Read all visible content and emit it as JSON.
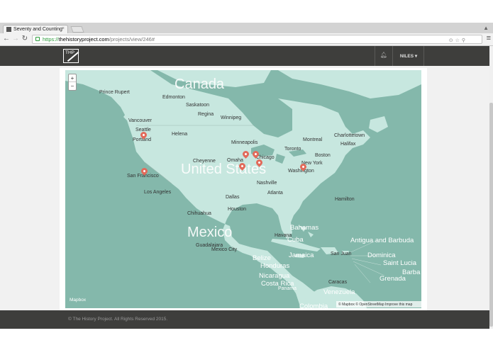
{
  "browser": {
    "tab_title": "Seventy and Counting",
    "url_scheme": "https://",
    "url_host": "thehistoryproject.com",
    "url_path": "/projects/view/246#"
  },
  "header": {
    "logo_text": "THP",
    "user_label": "NILES ▾"
  },
  "map": {
    "zoom_in": "+",
    "zoom_out": "−",
    "countries": {
      "canada": "Canada",
      "united_states": "United States",
      "mexico": "Mexico"
    },
    "cities": {
      "prince_rupert": "Prince Rupert",
      "edmonton": "Edmonton",
      "saskatoon": "Saskatoon",
      "regina": "Regina",
      "winnipeg": "Winnipeg",
      "vancouver": "Vancouver",
      "seattle": "Seattle",
      "portland": "Portland",
      "helena": "Helena",
      "minneapolis": "Minneapolis",
      "cheyenne": "Cheyenne",
      "omaha": "Omaha",
      "chicago": "Chicago",
      "toronto": "Toronto",
      "montreal": "Montreal",
      "charlottetown": "Charlottetown",
      "halifax": "Halifax",
      "boston": "Boston",
      "new_york": "New York",
      "washington": "Washington",
      "san_francisco": "San Francisco",
      "los_angeles": "Los Angeles",
      "nashville": "Nashville",
      "atlanta": "Atlanta",
      "dallas": "Dallas",
      "houston": "Houston",
      "chihuahua": "Chihuahua",
      "hamilton": "Hamilton",
      "guadalajara": "Guadalajara",
      "mexico_city": "Mexico City",
      "havana": "Havana",
      "san_juan": "San Juan",
      "caracas": "Caracas"
    },
    "regions": {
      "bahamas": "Bahamas",
      "cuba": "Cuba",
      "jamaica": "Jamaica",
      "belize": "Belize",
      "honduras": "Honduras",
      "nicaragua": "Nicaragua",
      "costa_rica": "Costa Rica",
      "panama": "Panama",
      "venezuela": "Venezuela",
      "colombia": "Colombia",
      "antigua": "Antigua and Barbuda",
      "dominica": "Dominica",
      "saint_lucia": "Saint Lucia",
      "barbados": "Barba",
      "grenada": "Grenada"
    },
    "wordmark": "Mapbox",
    "attribution": "© Mapbox © OpenStreetMap Improve this map",
    "pin_color": "#e26a5a",
    "water_color": "#84b8ab",
    "land_color": "#c7e7df"
  },
  "footer": {
    "copyright": "© The History Project. All Rights Reserved 2015."
  }
}
